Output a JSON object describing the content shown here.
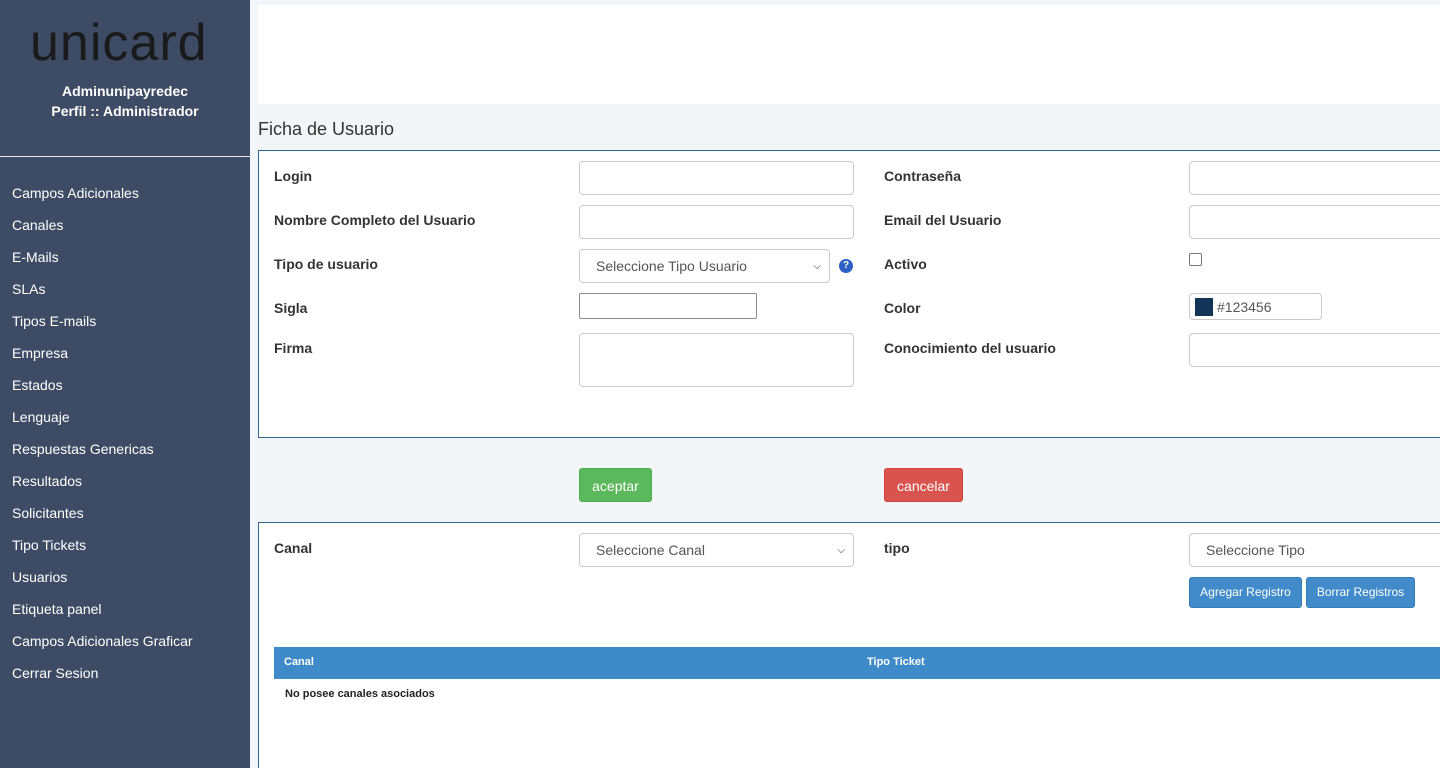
{
  "brand": {
    "logo_text": "unicard"
  },
  "user": {
    "name": "Adminunipayredec",
    "profile": "Perfil :: Administrador"
  },
  "sidebar": {
    "items": [
      {
        "label": "Campos Adicionales"
      },
      {
        "label": "Canales"
      },
      {
        "label": "E-Mails"
      },
      {
        "label": "SLAs"
      },
      {
        "label": "Tipos E-mails"
      },
      {
        "label": "Empresa"
      },
      {
        "label": "Estados"
      },
      {
        "label": "Lenguaje"
      },
      {
        "label": "Respuestas Genericas"
      },
      {
        "label": "Resultados"
      },
      {
        "label": "Solicitantes"
      },
      {
        "label": "Tipo Tickets"
      },
      {
        "label": "Usuarios"
      },
      {
        "label": "Etiqueta panel"
      },
      {
        "label": "Campos Adicionales Graficar"
      },
      {
        "label": "Cerrar Sesion"
      }
    ]
  },
  "page": {
    "title": "Ficha de Usuario"
  },
  "form": {
    "login_label": "Login",
    "login_value": "",
    "password_label": "Contraseña",
    "password_value": "",
    "fullname_label": "Nombre Completo del Usuario",
    "fullname_value": "",
    "email_label": "Email del Usuario",
    "email_value": "",
    "user_type_label": "Tipo de usuario",
    "user_type_selected": "Seleccione Tipo Usuario",
    "help_icon": "question-circle-icon",
    "active_label": "Activo",
    "active_checked": false,
    "sigla_label": "Sigla",
    "sigla_value": "",
    "color_label": "Color",
    "color_value": "#123456",
    "signature_label": "Firma",
    "signature_value": "",
    "knowledge_label": "Conocimiento del usuario",
    "knowledge_value": ""
  },
  "actions": {
    "accept_label": "aceptar",
    "cancel_label": "cancelar"
  },
  "canal_section": {
    "canal_label": "Canal",
    "canal_selected": "Seleccione Canal",
    "tipo_label": "tipo",
    "tipo_selected": "Seleccione Tipo",
    "add_label": "Agregar Registro",
    "delete_label": "Borrar Registros"
  },
  "table": {
    "columns": [
      "Canal",
      "Tipo Ticket"
    ],
    "empty_message": "No posee canales asociados"
  },
  "colors": {
    "sidebar_bg": "#3e4b64",
    "accept": "#5cb85c",
    "cancel": "#d9534f",
    "primary": "#428bca",
    "table_header": "#3f8ac8"
  }
}
